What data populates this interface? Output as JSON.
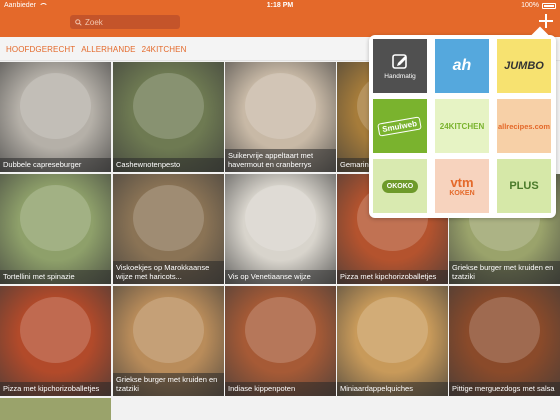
{
  "status": {
    "carrier": "Aanbieder",
    "time": "1:18 PM",
    "battery": "100%"
  },
  "search": {
    "placeholder": "Zoek"
  },
  "tabs": [
    "HOOFDGERECHT",
    "ALLERHANDE",
    "24KITCHEN"
  ],
  "recipes": [
    {
      "title": "Dubbele capreseburger",
      "bg": "#b5b0a8"
    },
    {
      "title": "Cashewnotenpesto",
      "bg": "#6e7a52"
    },
    {
      "title": "Suikervrije appeltaart met havermout en cranberrys",
      "bg": "#c8b9a6"
    },
    {
      "title": "Gemarin",
      "bg": "#a67c3a"
    },
    {
      "title": "Tortellini met spinazie",
      "bg": "#8ea06a"
    },
    {
      "title": "Viskoekjes op Marokkaanse wijze met haricots...",
      "bg": "#8a7355"
    },
    {
      "title": "Vis op Venetiaanse wijze",
      "bg": "#d8d4cc"
    },
    {
      "title": "Pizza met kipchorizoballetjes",
      "bg": "#b4532e"
    },
    {
      "title": "Griekse burger met kruiden en tzatziki",
      "bg": "#9aa36b"
    },
    {
      "title": "Pizza met kipchorizoballetjes",
      "bg": "#b24a2a"
    },
    {
      "title": "Griekse burger met kruiden en tzatziki",
      "bg": "#b98c5a"
    },
    {
      "title": "Indiase kippenpoten",
      "bg": "#a65a36"
    },
    {
      "title": "Miniaardappelquiches",
      "bg": "#c89a5a"
    },
    {
      "title": "Pittige merguezdogs met salsa",
      "bg": "#8a4a2a"
    }
  ],
  "sources": [
    {
      "name": "handmatig",
      "label": "Handmatig",
      "text": "",
      "bg": "#505050",
      "fg": "#ffffff",
      "icon": "edit-icon"
    },
    {
      "name": "ah",
      "label": "",
      "text": "ah",
      "bg": "#55a8dd",
      "fg": "#ffffff"
    },
    {
      "name": "jumbo",
      "label": "",
      "text": "JUMBO",
      "bg": "#f7e270",
      "fg": "#333333"
    },
    {
      "name": "smulweb",
      "label": "",
      "text": "Smulweb",
      "bg": "#7ab32e",
      "fg": "#ffffff"
    },
    {
      "name": "24kitchen",
      "label": "",
      "text": "24KITCHEN",
      "bg": "#e6f3c4",
      "fg": "#7ab32e"
    },
    {
      "name": "allrecipes",
      "label": "",
      "text": "allrecipes.com",
      "bg": "#f7d0a7",
      "fg": "#e4692a"
    },
    {
      "name": "okoko",
      "label": "",
      "text": "OKOKO",
      "bg": "#d9eab0",
      "fg": "#6e9a2a"
    },
    {
      "name": "vtm-koken",
      "label": "",
      "text": "vtm",
      "text2": "KOKEN",
      "bg": "#f7d3be",
      "fg": "#e4692a"
    },
    {
      "name": "24plus",
      "label": "",
      "text": "PLUS",
      "bg": "#d6e8a8",
      "fg": "#4a7a2a"
    }
  ],
  "colors": {
    "brand": "#e4692a"
  }
}
